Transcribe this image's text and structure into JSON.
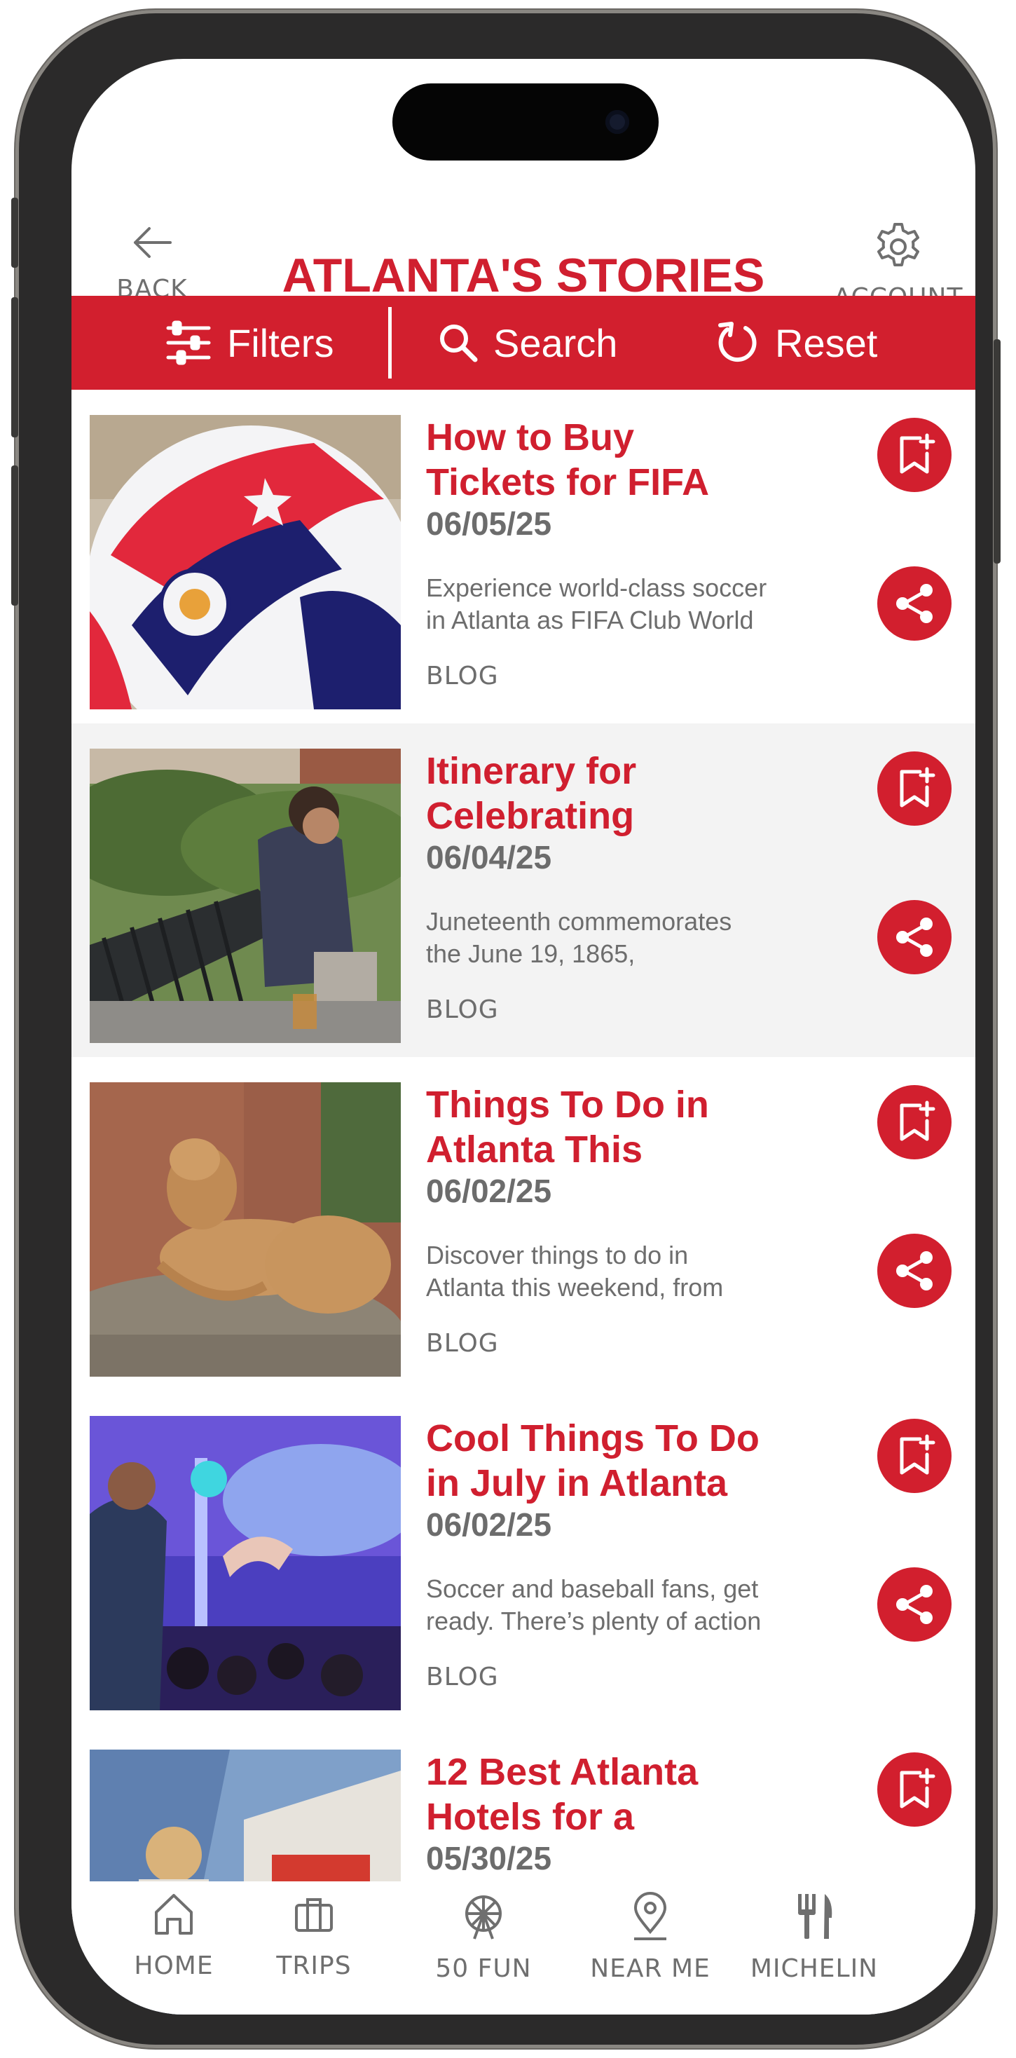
{
  "header": {
    "title": "ATLANTA'S STORIES",
    "back_label": "BACK",
    "account_label": "ACCOUNT"
  },
  "actions": {
    "filters_label": "Filters",
    "search_label": "Search",
    "reset_label": "Reset"
  },
  "stories": [
    {
      "title_lines": [
        "How to Buy",
        "Tickets for FIFA"
      ],
      "date": "06/05/25",
      "desc_lines": [
        "Experience world-class soccer",
        "in Atlanta as FIFA Club World"
      ],
      "category": "BLOG"
    },
    {
      "title_lines": [
        "Itinerary for",
        "Celebrating"
      ],
      "date": "06/04/25",
      "desc_lines": [
        "Juneteenth commemorates",
        "the June 19, 1865,"
      ],
      "category": "BLOG"
    },
    {
      "title_lines": [
        "Things To Do in",
        "Atlanta This"
      ],
      "date": "06/02/25",
      "desc_lines": [
        "Discover things to do in",
        "Atlanta this weekend, from"
      ],
      "category": "BLOG"
    },
    {
      "title_lines": [
        "Cool Things To Do",
        "in July in Atlanta"
      ],
      "date": "06/02/25",
      "desc_lines": [
        "Soccer and baseball fans, get",
        "ready. There’s plenty of action"
      ],
      "category": "BLOG"
    },
    {
      "title_lines": [
        "12 Best Atlanta",
        "Hotels for a"
      ],
      "date": "05/30/25",
      "desc_lines": [
        "",
        ""
      ],
      "category": ""
    }
  ],
  "nav": {
    "home": "HOME",
    "trips": "TRIPS",
    "fun": "50 FUN",
    "near": "NEAR ME",
    "michelin": "MICHELIN"
  },
  "colors": {
    "brand_red": "#d21f2e",
    "text_gray": "#6d6d6d"
  },
  "icons": {
    "back": "arrow-left-icon",
    "account": "gear-icon",
    "filters": "sliders-icon",
    "search": "search-icon",
    "reset": "refresh-icon",
    "save": "bookmark-plus-icon",
    "share": "share-icon",
    "home": "home-icon",
    "trips": "briefcase-icon",
    "fun": "ferris-wheel-icon",
    "near": "map-pin-icon",
    "michelin": "fork-knife-icon"
  }
}
